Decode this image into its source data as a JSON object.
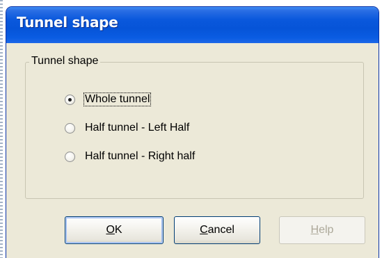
{
  "window": {
    "title": "Tunnel shape"
  },
  "group": {
    "label": "Tunnel shape"
  },
  "options": [
    {
      "label": "Whole tunnel",
      "checked": true
    },
    {
      "label": "Half tunnel - Left Half",
      "checked": false
    },
    {
      "label": "Half tunnel - Right half",
      "checked": false
    }
  ],
  "buttons": {
    "ok": {
      "mnemonic": "O",
      "rest": "K"
    },
    "cancel": {
      "mnemonic": "C",
      "rest": "ancel"
    },
    "help": {
      "mnemonic": "H",
      "rest": "elp",
      "enabled": false
    }
  },
  "colors": {
    "titlebar": "#0a58dc",
    "dialog_bg": "#ece9d8",
    "button_border": "#003c74",
    "disabled_text": "#aca899"
  }
}
